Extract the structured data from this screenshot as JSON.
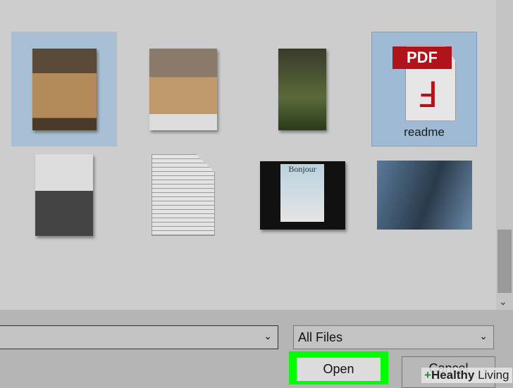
{
  "files": [
    {
      "name": "",
      "kind": "photo-table",
      "selected": true
    },
    {
      "name": "",
      "kind": "photo-table-2"
    },
    {
      "name": "",
      "kind": "photo-child"
    },
    {
      "name": "readme",
      "kind": "pdf",
      "selected": true,
      "badge": "PDF"
    },
    {
      "name": "",
      "kind": "photo-sink"
    },
    {
      "name": "",
      "kind": "text-document"
    },
    {
      "name": "",
      "kind": "photo-bonjour",
      "caption": "Bonjour"
    },
    {
      "name": "",
      "kind": "photo-singer"
    }
  ],
  "filename_value": "",
  "filter": "All Files",
  "open_label": "Open",
  "cancel_label": "Cancel",
  "watermark": {
    "brand": "Healthy",
    "suffix": "Living"
  },
  "colors": {
    "highlight": "#00ff00",
    "pdf_red": "#b0141a"
  }
}
